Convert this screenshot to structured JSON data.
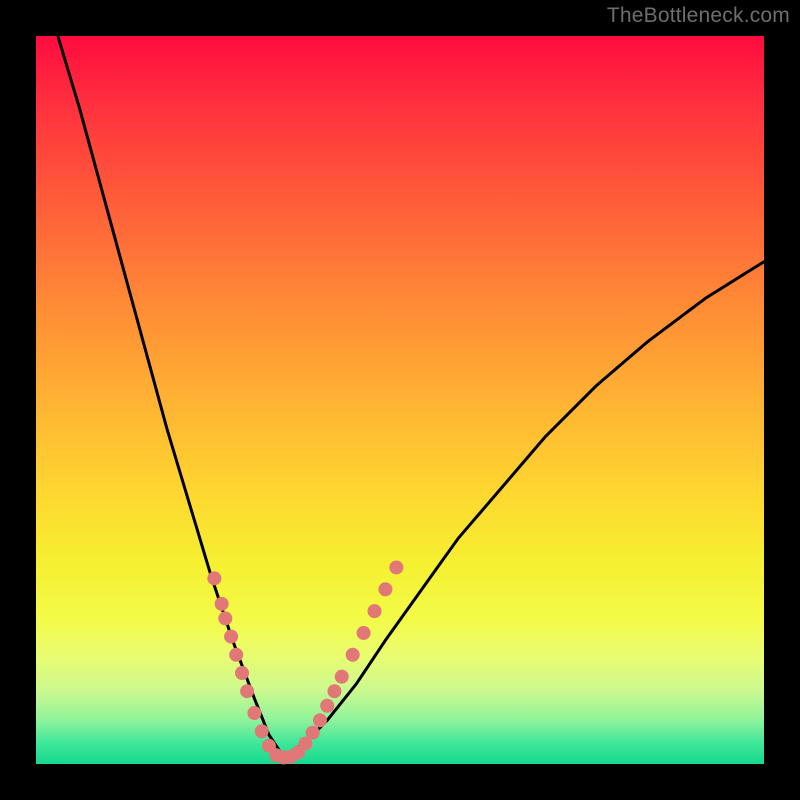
{
  "watermark": "TheBottleneck.com",
  "colors": {
    "background": "#000000",
    "curve": "#000000",
    "dots": "#e17877",
    "gradient_stops": [
      "#ff0b3f",
      "#ff2f3e",
      "#ff5a3a",
      "#ff8836",
      "#ffb233",
      "#ffd530",
      "#f6ef30",
      "#f3fb47",
      "#eafc6f",
      "#cbf990",
      "#8ef39a",
      "#42e79a",
      "#15d98f"
    ]
  },
  "chart_data": {
    "type": "line",
    "title": "",
    "xlabel": "",
    "ylabel": "",
    "xlim": [
      0,
      100
    ],
    "ylim": [
      0,
      100
    ],
    "note": "Axis values estimated from pixel positions; chart is a V-shaped bottleneck curve with minimum near x≈33. Dots are sample markers along the curve near the bottom.",
    "series": [
      {
        "name": "left-branch",
        "x": [
          3,
          6,
          9,
          12,
          15,
          18,
          21,
          24,
          27,
          30,
          32,
          34
        ],
        "values": [
          100,
          90,
          79,
          68,
          57,
          46,
          36,
          26,
          17,
          9,
          4,
          1
        ]
      },
      {
        "name": "right-branch",
        "x": [
          34,
          37,
          40,
          44,
          48,
          53,
          58,
          64,
          70,
          77,
          84,
          92,
          100
        ],
        "values": [
          1,
          3,
          6,
          11,
          17,
          24,
          31,
          38,
          45,
          52,
          58,
          64,
          69
        ]
      }
    ],
    "markers": [
      {
        "x": 24.5,
        "y": 25.5
      },
      {
        "x": 25.5,
        "y": 22.0
      },
      {
        "x": 26.0,
        "y": 20.0
      },
      {
        "x": 26.8,
        "y": 17.5
      },
      {
        "x": 27.5,
        "y": 15.0
      },
      {
        "x": 28.3,
        "y": 12.5
      },
      {
        "x": 29.0,
        "y": 10.0
      },
      {
        "x": 30.0,
        "y": 7.0
      },
      {
        "x": 31.0,
        "y": 4.5
      },
      {
        "x": 32.0,
        "y": 2.5
      },
      {
        "x": 33.0,
        "y": 1.2
      },
      {
        "x": 34.0,
        "y": 0.9
      },
      {
        "x": 35.0,
        "y": 1.0
      },
      {
        "x": 36.0,
        "y": 1.6
      },
      {
        "x": 37.0,
        "y": 2.8
      },
      {
        "x": 38.0,
        "y": 4.3
      },
      {
        "x": 39.0,
        "y": 6.0
      },
      {
        "x": 40.0,
        "y": 8.0
      },
      {
        "x": 41.0,
        "y": 10.0
      },
      {
        "x": 42.0,
        "y": 12.0
      },
      {
        "x": 43.5,
        "y": 15.0
      },
      {
        "x": 45.0,
        "y": 18.0
      },
      {
        "x": 46.5,
        "y": 21.0
      },
      {
        "x": 48.0,
        "y": 24.0
      },
      {
        "x": 49.5,
        "y": 27.0
      }
    ]
  }
}
